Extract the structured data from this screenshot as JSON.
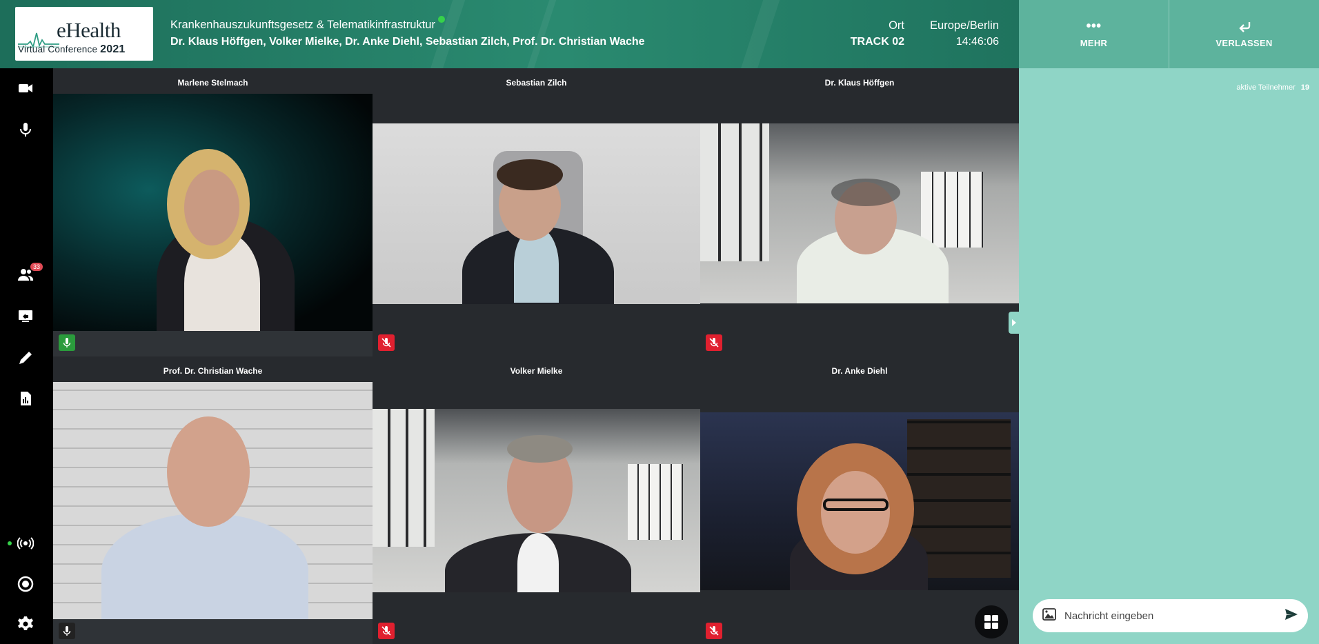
{
  "header": {
    "logo_word": "eHealth",
    "logo_sub_text": "Virtual Conference",
    "logo_year": "2021",
    "session_title": "Krankenhauszukunftsgesetz & Telematikinfrastruktur",
    "speakers": "Dr. Klaus Höffgen, Volker Mielke, Dr. Anke Diehl, Sebastian Zilch, Prof. Dr. Christian Wache",
    "location_label": "Ort",
    "track": "TRACK 02",
    "timezone": "Europe/Berlin",
    "time": "14:46:06",
    "live_color": "#36d14a"
  },
  "top_buttons": {
    "more_label": "MEHR",
    "more_icon": "dots-icon",
    "leave_label": "VERLASSEN",
    "leave_icon": "return-arrow-icon"
  },
  "sidebar": {
    "participants_badge": "33",
    "icons": [
      "camera-icon",
      "microphone-icon",
      "participants-icon",
      "screen-share-icon",
      "pen-icon",
      "document-icon",
      "broadcast-icon",
      "record-icon",
      "gear-icon"
    ]
  },
  "tiles": [
    {
      "name": "Marlene Stelmach",
      "mic": "on"
    },
    {
      "name": "Sebastian Zilch",
      "mic": "muted"
    },
    {
      "name": "Dr. Klaus Höffgen",
      "mic": "muted"
    },
    {
      "name": "Prof. Dr. Christian Wache",
      "mic": "idle"
    },
    {
      "name": "Volker Mielke",
      "mic": "muted"
    },
    {
      "name": "Dr. Anke Diehl",
      "mic": "muted"
    }
  ],
  "chat": {
    "participants_label": "aktive Teilnehmer",
    "participants_count": "19",
    "input_placeholder": "Nachricht eingeben"
  },
  "colors": {
    "header_green": "#2a8a70",
    "chat_panel": "#8fd5c6",
    "mic_on": "#2a9b3c",
    "mic_muted": "#e0202f"
  }
}
